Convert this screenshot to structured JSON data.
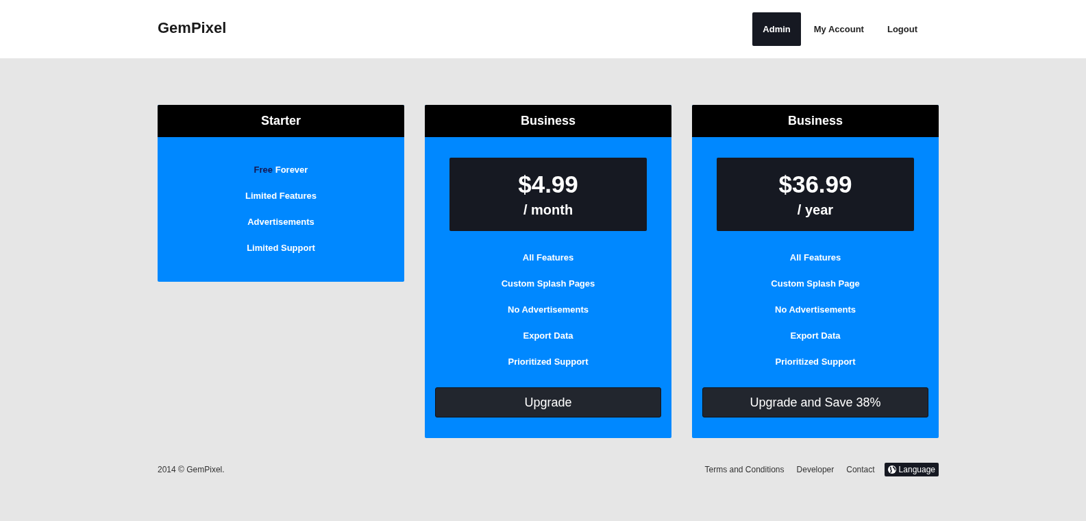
{
  "brand": "GemPixel",
  "nav": [
    {
      "label": "Admin",
      "selected": true
    },
    {
      "label": "My Account",
      "selected": false
    },
    {
      "label": "Logout",
      "selected": false
    }
  ],
  "plans": [
    {
      "name": "Starter",
      "features": [
        {
          "lead": "Free",
          "text": "Forever"
        },
        {
          "text": "Limited Features"
        },
        {
          "text": "Advertisements"
        },
        {
          "text": "Limited Support"
        }
      ]
    },
    {
      "name": "Business",
      "price": "$4.99",
      "period": "/ month",
      "features": [
        {
          "text": "All Features"
        },
        {
          "text": "Custom Splash Pages"
        },
        {
          "text": "No Advertisements"
        },
        {
          "text": "Export Data"
        },
        {
          "text": "Prioritized Support"
        }
      ],
      "button": "Upgrade"
    },
    {
      "name": "Business",
      "price": "$36.99",
      "period": "/ year",
      "features": [
        {
          "text": "All Features"
        },
        {
          "text": "Custom Splash Page"
        },
        {
          "text": "No Advertisements"
        },
        {
          "text": "Export Data"
        },
        {
          "text": "Prioritized Support"
        }
      ],
      "button": "Upgrade and Save 38%"
    }
  ],
  "footer": {
    "copyright": "2014 © GemPixel.",
    "links": [
      "Terms and Conditions",
      "Developer",
      "Contact"
    ],
    "language": "Language"
  }
}
